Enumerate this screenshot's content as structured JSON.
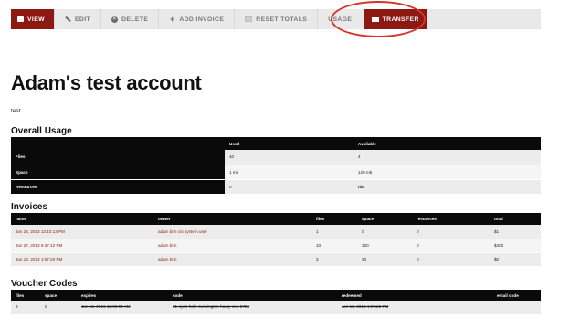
{
  "toolbar": {
    "view": "VIEW",
    "edit": "EDIT",
    "delete": "DELETE",
    "add_invoice": "ADD INVOICE",
    "reset_totals": "RESET TOTALS",
    "usage": "USAGE",
    "transfer": "TRANSFER"
  },
  "colors": {
    "accent": "#8d1a12",
    "annotation": "#d6342a",
    "table_header": "#0a0a0a"
  },
  "page": {
    "title": "Adam's test account",
    "subtitle": "test"
  },
  "overall_usage": {
    "title": "Overall Usage",
    "columns": [
      "",
      "Used",
      "Available"
    ],
    "rows": [
      {
        "label": "Files",
        "used": "10",
        "available": "4"
      },
      {
        "label": "Space",
        "used": "1 mb",
        "available": "129 mb"
      },
      {
        "label": "Resources",
        "used": "0",
        "available": "n/a"
      }
    ]
  },
  "invoices": {
    "title": "Invoices",
    "columns": [
      "name",
      "owner",
      "files",
      "space",
      "resources",
      "total"
    ],
    "rows": [
      {
        "name": "Jan 25, 2013 12:10:13 PM",
        "owner": "adam brin c/o system user",
        "files": "1",
        "space": "0",
        "resources": "0",
        "total": "$1"
      },
      {
        "name": "Jan 27, 2013 9:27:12 PM",
        "owner": "adam brin",
        "files": "10",
        "space": "100",
        "resources": "0",
        "total": "$400"
      },
      {
        "name": "Jan 13, 2013 1:07:25 PM",
        "owner": "adam brin",
        "files": "3",
        "space": "30",
        "resources": "0",
        "total": "$0"
      }
    ]
  },
  "vouchers": {
    "title": "Voucher Codes",
    "columns": [
      "files",
      "space",
      "expires",
      "code",
      "redeemed",
      "email code"
    ],
    "rows": [
      {
        "files": "3",
        "space": "0",
        "expires": "Jan 12, 2016 12:00:00 AM",
        "code": "81-cyan-hole-cunnington-hauty-cnn-5755",
        "redeemed": "Jan 13, 2013 1:07:25 PM",
        "email_code": ""
      }
    ]
  }
}
